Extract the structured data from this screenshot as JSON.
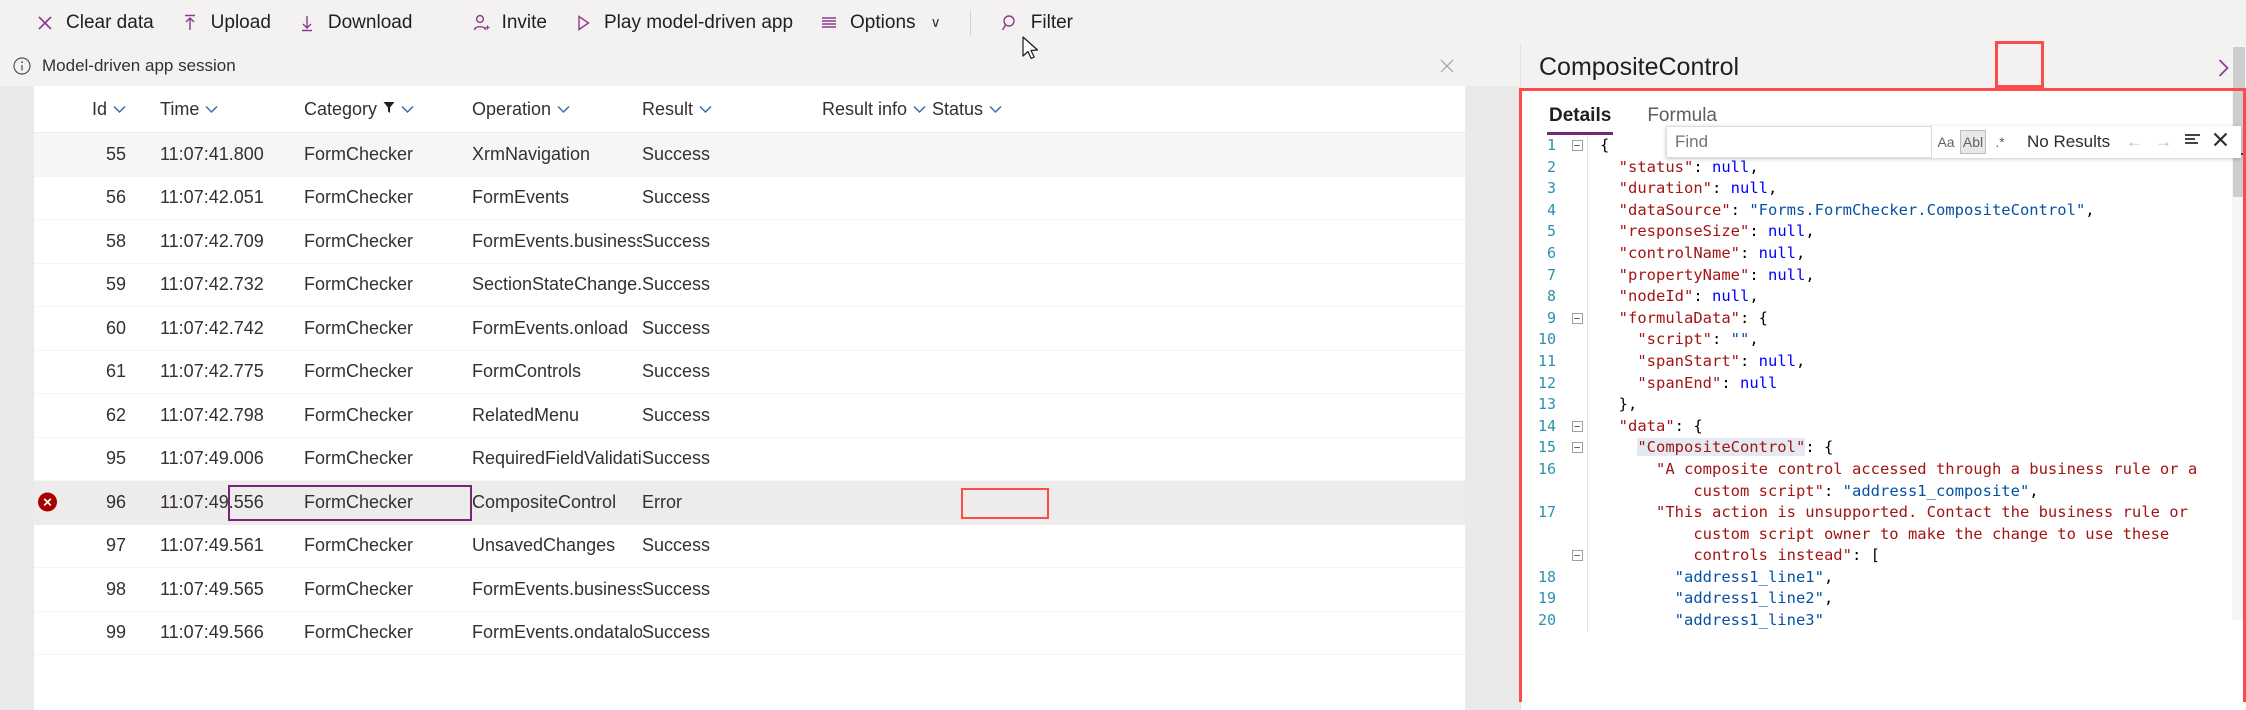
{
  "commandbar": {
    "left_buttons": [
      {
        "label": "Clear data",
        "icon": "close-x-icon"
      },
      {
        "label": "Upload",
        "icon": "upload-arrow-icon"
      },
      {
        "label": "Download",
        "icon": "download-arrow-icon"
      }
    ],
    "right_buttons": [
      {
        "label": "Invite",
        "icon": "person-add-icon",
        "chevron": ""
      },
      {
        "label": "Play model-driven app",
        "icon": "play-triangle-icon",
        "chevron": ""
      },
      {
        "label": "Options",
        "icon": "list-lines-icon",
        "chevron": "∨"
      },
      {
        "label": "Filter",
        "icon": "search-magnifier-icon",
        "chevron": ""
      }
    ]
  },
  "session": {
    "label": "Model-driven app session",
    "info_icon": "info-circle-icon",
    "close_icon": "close-x-icon"
  },
  "table": {
    "columns": [
      {
        "key": "id",
        "label": "Id",
        "sort_icon": "chevron-down-icon",
        "filtered": false
      },
      {
        "key": "time",
        "label": "Time",
        "sort_icon": "chevron-down-icon",
        "filtered": false
      },
      {
        "key": "category",
        "label": "Category",
        "sort_icon": "chevron-down-icon",
        "filtered": true,
        "filter_icon": "funnel-icon"
      },
      {
        "key": "operation",
        "label": "Operation",
        "sort_icon": "chevron-down-icon",
        "filtered": false
      },
      {
        "key": "result",
        "label": "Result",
        "sort_icon": "chevron-down-icon",
        "filtered": false
      },
      {
        "key": "result_info",
        "label": "Result info",
        "sort_icon": "chevron-down-icon",
        "filtered": false
      },
      {
        "key": "status",
        "label": "Status",
        "sort_icon": "chevron-down-icon",
        "filtered": false
      }
    ],
    "rows": [
      {
        "id": "55",
        "time": "11:07:41.800",
        "category": "FormChecker",
        "operation": "XrmNavigation",
        "result": "Success",
        "result_info": "",
        "status": "",
        "state": "alt"
      },
      {
        "id": "56",
        "time": "11:07:42.051",
        "category": "FormChecker",
        "operation": "FormEvents",
        "result": "Success",
        "result_info": "",
        "status": "",
        "state": "normal"
      },
      {
        "id": "58",
        "time": "11:07:42.709",
        "category": "FormChecker",
        "operation": "FormEvents.businessrule",
        "result": "Success",
        "result_info": "",
        "status": "",
        "state": "normal"
      },
      {
        "id": "59",
        "time": "11:07:42.732",
        "category": "FormChecker",
        "operation": "SectionStateChange.vi...",
        "result": "Success",
        "result_info": "",
        "status": "",
        "state": "normal"
      },
      {
        "id": "60",
        "time": "11:07:42.742",
        "category": "FormChecker",
        "operation": "FormEvents.onload",
        "result": "Success",
        "result_info": "",
        "status": "",
        "state": "normal"
      },
      {
        "id": "61",
        "time": "11:07:42.775",
        "category": "FormChecker",
        "operation": "FormControls",
        "result": "Success",
        "result_info": "",
        "status": "",
        "state": "normal"
      },
      {
        "id": "62",
        "time": "11:07:42.798",
        "category": "FormChecker",
        "operation": "RelatedMenu",
        "result": "Success",
        "result_info": "",
        "status": "",
        "state": "normal"
      },
      {
        "id": "95",
        "time": "11:07:49.006",
        "category": "FormChecker",
        "operation": "RequiredFieldValidation",
        "result": "Success",
        "result_info": "",
        "status": "",
        "state": "normal"
      },
      {
        "id": "96",
        "time": "11:07:49.556",
        "category": "FormChecker",
        "operation": "CompositeControl",
        "result": "Error",
        "result_info": "",
        "status": "",
        "state": "error"
      },
      {
        "id": "97",
        "time": "11:07:49.561",
        "category": "FormChecker",
        "operation": "UnsavedChanges",
        "result": "Success",
        "result_info": "",
        "status": "",
        "state": "normal"
      },
      {
        "id": "98",
        "time": "11:07:49.565",
        "category": "FormChecker",
        "operation": "FormEvents.businessrule",
        "result": "Success",
        "result_info": "",
        "status": "",
        "state": "normal"
      },
      {
        "id": "99",
        "time": "11:07:49.566",
        "category": "FormChecker",
        "operation": "FormEvents.ondataload",
        "result": "Success",
        "result_info": "",
        "status": "",
        "state": "normal"
      }
    ],
    "error_row_icon": "error-circle-icon"
  },
  "panel": {
    "title": "CompositeControl",
    "expand_icon": "chevron-right-icon",
    "tabs": [
      {
        "label": "Details",
        "active": true
      },
      {
        "label": "Formula",
        "active": false
      }
    ]
  },
  "find": {
    "placeholder": "Find",
    "value": "",
    "match_case_label": "Aa",
    "match_word_label": "Abl",
    "regex_label": ".*",
    "status": "No Results",
    "prev_icon": "arrow-left-icon",
    "next_icon": "arrow-right-icon",
    "selection_icon": "find-in-selection-icon",
    "close_icon": "close-x-icon"
  },
  "code": {
    "lines": [
      {
        "num": "1",
        "fold": "minus",
        "indent": 0,
        "tokens": [
          {
            "t": "{",
            "c": "p"
          }
        ]
      },
      {
        "num": "2",
        "fold": "",
        "indent": 1,
        "tokens": [
          {
            "t": "\"status\"",
            "c": "k"
          },
          {
            "t": ": ",
            "c": "p"
          },
          {
            "t": "null",
            "c": "n"
          },
          {
            "t": ",",
            "c": "p"
          }
        ]
      },
      {
        "num": "3",
        "fold": "",
        "indent": 1,
        "tokens": [
          {
            "t": "\"duration\"",
            "c": "k"
          },
          {
            "t": ": ",
            "c": "p"
          },
          {
            "t": "null",
            "c": "n"
          },
          {
            "t": ",",
            "c": "p"
          }
        ]
      },
      {
        "num": "4",
        "fold": "",
        "indent": 1,
        "tokens": [
          {
            "t": "\"dataSource\"",
            "c": "k"
          },
          {
            "t": ": ",
            "c": "p"
          },
          {
            "t": "\"Forms.FormChecker.CompositeControl\"",
            "c": "s"
          },
          {
            "t": ",",
            "c": "p"
          }
        ]
      },
      {
        "num": "5",
        "fold": "",
        "indent": 1,
        "tokens": [
          {
            "t": "\"responseSize\"",
            "c": "k"
          },
          {
            "t": ": ",
            "c": "p"
          },
          {
            "t": "null",
            "c": "n"
          },
          {
            "t": ",",
            "c": "p"
          }
        ]
      },
      {
        "num": "6",
        "fold": "",
        "indent": 1,
        "tokens": [
          {
            "t": "\"controlName\"",
            "c": "k"
          },
          {
            "t": ": ",
            "c": "p"
          },
          {
            "t": "null",
            "c": "n"
          },
          {
            "t": ",",
            "c": "p"
          }
        ]
      },
      {
        "num": "7",
        "fold": "",
        "indent": 1,
        "tokens": [
          {
            "t": "\"propertyName\"",
            "c": "k"
          },
          {
            "t": ": ",
            "c": "p"
          },
          {
            "t": "null",
            "c": "n"
          },
          {
            "t": ",",
            "c": "p"
          }
        ]
      },
      {
        "num": "8",
        "fold": "",
        "indent": 1,
        "tokens": [
          {
            "t": "\"nodeId\"",
            "c": "k"
          },
          {
            "t": ": ",
            "c": "p"
          },
          {
            "t": "null",
            "c": "n"
          },
          {
            "t": ",",
            "c": "p"
          }
        ]
      },
      {
        "num": "9",
        "fold": "minus",
        "indent": 1,
        "tokens": [
          {
            "t": "\"formulaData\"",
            "c": "k"
          },
          {
            "t": ": {",
            "c": "p"
          }
        ]
      },
      {
        "num": "10",
        "fold": "",
        "indent": 2,
        "tokens": [
          {
            "t": "\"script\"",
            "c": "k"
          },
          {
            "t": ": ",
            "c": "p"
          },
          {
            "t": "\"\"",
            "c": "s"
          },
          {
            "t": ",",
            "c": "p"
          }
        ]
      },
      {
        "num": "11",
        "fold": "",
        "indent": 2,
        "tokens": [
          {
            "t": "\"spanStart\"",
            "c": "k"
          },
          {
            "t": ": ",
            "c": "p"
          },
          {
            "t": "null",
            "c": "n"
          },
          {
            "t": ",",
            "c": "p"
          }
        ]
      },
      {
        "num": "12",
        "fold": "",
        "indent": 2,
        "tokens": [
          {
            "t": "\"spanEnd\"",
            "c": "k"
          },
          {
            "t": ": ",
            "c": "p"
          },
          {
            "t": "null",
            "c": "n"
          }
        ]
      },
      {
        "num": "13",
        "fold": "",
        "indent": 1,
        "tokens": [
          {
            "t": "},",
            "c": "p"
          }
        ]
      },
      {
        "num": "14",
        "fold": "minus",
        "indent": 1,
        "tokens": [
          {
            "t": "\"data\"",
            "c": "k"
          },
          {
            "t": ": {",
            "c": "p"
          }
        ]
      },
      {
        "num": "15",
        "fold": "minus",
        "indent": 2,
        "tokens": [
          {
            "t": "\"CompositeControl\"",
            "c": "k hl"
          },
          {
            "t": ": {",
            "c": "p"
          }
        ]
      },
      {
        "num": "16",
        "fold": "",
        "indent": 3,
        "tokens": [
          {
            "t": "\"A composite control accessed through a business rule or a",
            "c": "k"
          }
        ]
      },
      {
        "num": "",
        "fold": "",
        "indent": 5,
        "tokens": [
          {
            "t": "custom script\"",
            "c": "k"
          },
          {
            "t": ": ",
            "c": "p"
          },
          {
            "t": "\"address1_composite\"",
            "c": "s"
          },
          {
            "t": ",",
            "c": "p"
          }
        ]
      },
      {
        "num": "17",
        "fold": "",
        "indent": 3,
        "tokens": [
          {
            "t": "\"This action is unsupported. Contact the business rule or",
            "c": "k"
          }
        ]
      },
      {
        "num": "",
        "fold": "",
        "indent": 5,
        "tokens": [
          {
            "t": "custom script owner to make the change to use these",
            "c": "k"
          }
        ]
      },
      {
        "num": "",
        "fold": "minus",
        "indent": 5,
        "tokens": [
          {
            "t": "controls instead\"",
            "c": "k"
          },
          {
            "t": ": [",
            "c": "p"
          }
        ]
      },
      {
        "num": "18",
        "fold": "",
        "indent": 4,
        "tokens": [
          {
            "t": "\"address1_line1\"",
            "c": "s"
          },
          {
            "t": ",",
            "c": "p"
          }
        ]
      },
      {
        "num": "19",
        "fold": "",
        "indent": 4,
        "tokens": [
          {
            "t": "\"address1_line2\"",
            "c": "s"
          },
          {
            "t": ",",
            "c": "p"
          }
        ]
      },
      {
        "num": "20",
        "fold": "",
        "indent": 4,
        "tokens": [
          {
            "t": "\"address1_line3\"",
            "c": "s"
          }
        ]
      }
    ]
  },
  "colors": {
    "accent_purple": "#742774",
    "brand_purple": "#8b3a8b",
    "error_red": "#a80000",
    "highlight_red": "#fb4b4b",
    "toolbar_bg": "#f3f2f1",
    "gutter_gray": "#eaeaea"
  }
}
